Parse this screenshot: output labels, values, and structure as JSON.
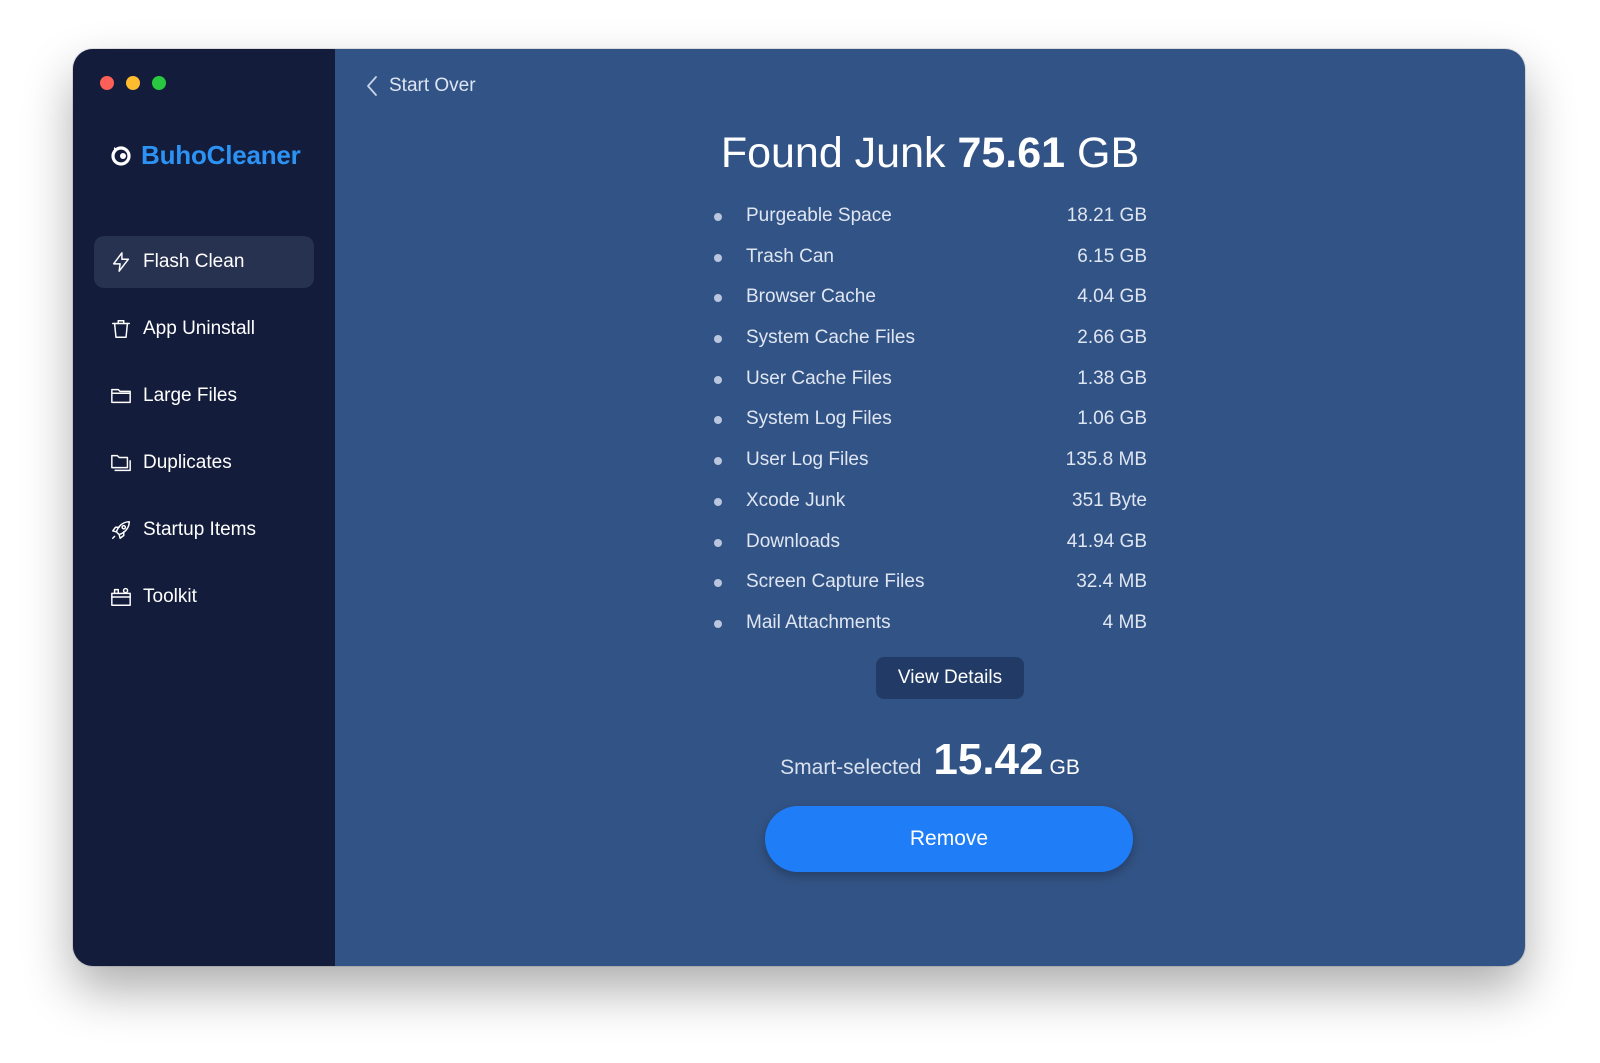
{
  "app": {
    "name": "BuhoCleaner"
  },
  "sidebar": {
    "items": [
      {
        "label": "Flash Clean",
        "icon": "bolt-icon",
        "active": true
      },
      {
        "label": "App Uninstall",
        "icon": "trash-icon",
        "active": false
      },
      {
        "label": "Large Files",
        "icon": "folder-icon",
        "active": false
      },
      {
        "label": "Duplicates",
        "icon": "duplicate-folder-icon",
        "active": false
      },
      {
        "label": "Startup Items",
        "icon": "rocket-icon",
        "active": false
      },
      {
        "label": "Toolkit",
        "icon": "toolbox-icon",
        "active": false
      }
    ]
  },
  "header": {
    "back_label": "Start Over"
  },
  "summary": {
    "prefix": "Found Junk",
    "total_value": "75.61",
    "total_unit": "GB"
  },
  "junk_items": [
    {
      "name": "Purgeable Space",
      "size": "18.21 GB"
    },
    {
      "name": "Trash Can",
      "size": "6.15 GB"
    },
    {
      "name": "Browser Cache",
      "size": "4.04 GB"
    },
    {
      "name": "System Cache Files",
      "size": "2.66 GB"
    },
    {
      "name": "User Cache Files",
      "size": "1.38 GB"
    },
    {
      "name": "System Log Files",
      "size": "1.06 GB"
    },
    {
      "name": "User Log Files",
      "size": "135.8 MB"
    },
    {
      "name": "Xcode Junk",
      "size": "351 Byte"
    },
    {
      "name": "Downloads",
      "size": "41.94 GB"
    },
    {
      "name": "Screen Capture Files",
      "size": "32.4 MB"
    },
    {
      "name": "Mail Attachments",
      "size": "4 MB"
    }
  ],
  "actions": {
    "view_details_label": "View Details",
    "remove_label": "Remove"
  },
  "selection": {
    "label": "Smart-selected",
    "value": "15.42",
    "unit": "GB"
  },
  "colors": {
    "sidebar_bg": "#131c3b",
    "main_bg": "#325385",
    "brand": "#2c93f5",
    "primary_button": "#1f7ef7"
  }
}
